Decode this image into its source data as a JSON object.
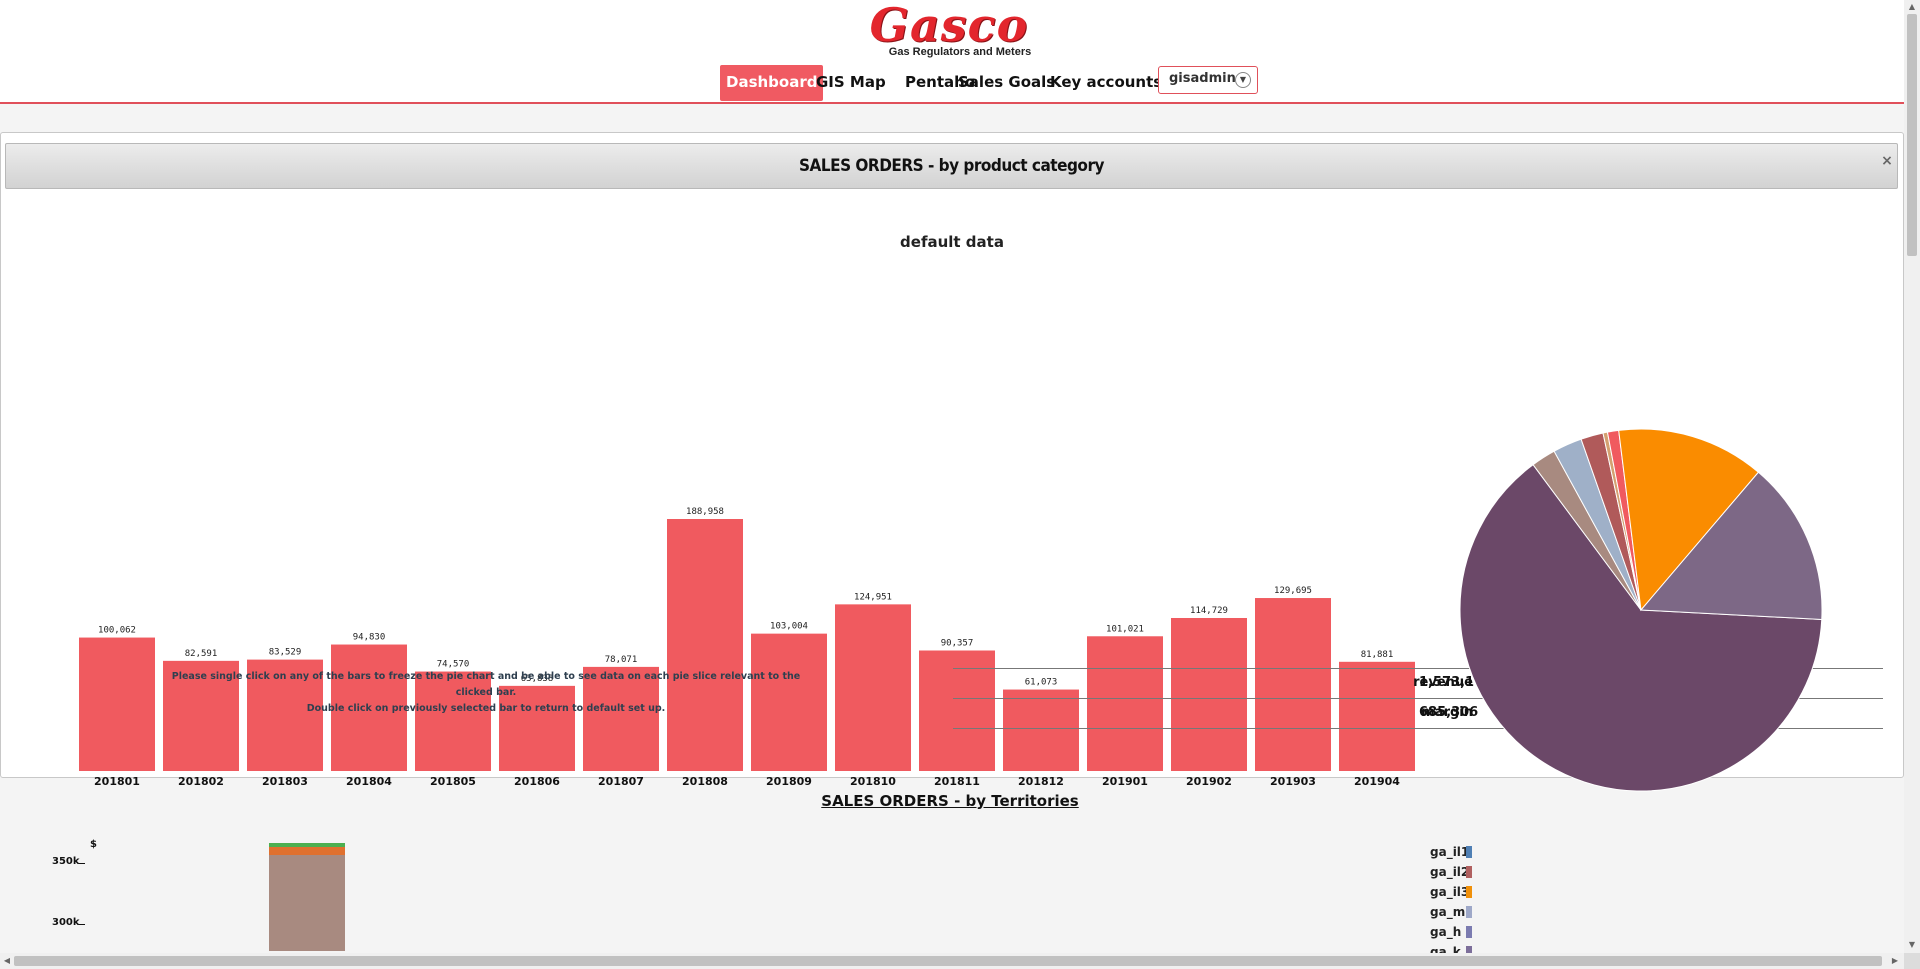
{
  "brand": {
    "logo_text": "Gasco",
    "tagline": "Gas Regulators and Meters"
  },
  "nav": {
    "items": [
      {
        "label": "Dashboard",
        "active": true
      },
      {
        "label": "GIS Map",
        "active": false
      },
      {
        "label": "Pentaho",
        "active": false
      },
      {
        "label": "Sales Goals",
        "active": false
      },
      {
        "label": "Key accounts",
        "active": false
      }
    ],
    "user": "gisadmin"
  },
  "panel": {
    "title": "SALES ORDERS - by product category",
    "close_symbol": "×"
  },
  "chart_data": [
    {
      "type": "bar",
      "title": "default data",
      "categories": [
        "201801",
        "201802",
        "201803",
        "201804",
        "201805",
        "201806",
        "201807",
        "201808",
        "201809",
        "201810",
        "201811",
        "201812",
        "201901",
        "201902",
        "201903",
        "201904"
      ],
      "values": [
        100062,
        82591,
        83529,
        94830,
        74570,
        63838,
        78071,
        188958,
        103004,
        124951,
        90357,
        61073,
        101021,
        114729,
        129695,
        81881
      ],
      "value_labels": [
        "100,062",
        "82,591",
        "83,529",
        "94,830",
        "74,570",
        "63,838",
        "78,071",
        "188,958",
        "103,004",
        "124,951",
        "90,357",
        "61,073",
        "101,021",
        "114,729",
        "129,695",
        "81,881"
      ],
      "color": "#f05a5f",
      "ylim": [
        0,
        200000
      ]
    },
    {
      "type": "pie",
      "slices": [
        {
          "value": 0.64,
          "color": "#6b4868"
        },
        {
          "value": 0.022,
          "color": "#a88a80"
        },
        {
          "value": 0.026,
          "color": "#9fb0c8"
        },
        {
          "value": 0.02,
          "color": "#b05a5a"
        },
        {
          "value": 0.004,
          "color": "#d4a070"
        },
        {
          "value": 0.01,
          "color": "#f05a5f"
        },
        {
          "value": 0.132,
          "color": "#fa8c00"
        },
        {
          "value": 0.146,
          "color": "#7d6886"
        }
      ]
    }
  ],
  "hint": {
    "line1": "Please single click on any of the bars to freeze the pie chart and be able to see data on each pie slice relevant to the clicked bar.",
    "line2": "Double click on previously selected bar to return to default set up."
  },
  "legend": [
    {
      "name": "revenue",
      "value": "1,573,160",
      "color": "#f05a5f"
    },
    {
      "name": "margin",
      "value": "685,306",
      "color": "#f05a5f"
    }
  ],
  "territories": {
    "title": "SALES ORDERS - by Territories",
    "y_unit": "$",
    "y_ticks": [
      "350k",
      "300k"
    ],
    "legend": [
      {
        "name": "ga_il1",
        "color": "#4f7fb4"
      },
      {
        "name": "ga_il2",
        "color": "#b06060"
      },
      {
        "name": "ga_il3",
        "color": "#f0900a"
      },
      {
        "name": "ga_mi",
        "color": "#9ea8c8"
      },
      {
        "name": "ga_h",
        "color": "#7b7bb0"
      },
      {
        "name": "ga_k",
        "color": "#7c6e9a"
      }
    ],
    "first_bar_colors": [
      "#4caf50",
      "#e0702e",
      "#a88a80"
    ]
  }
}
